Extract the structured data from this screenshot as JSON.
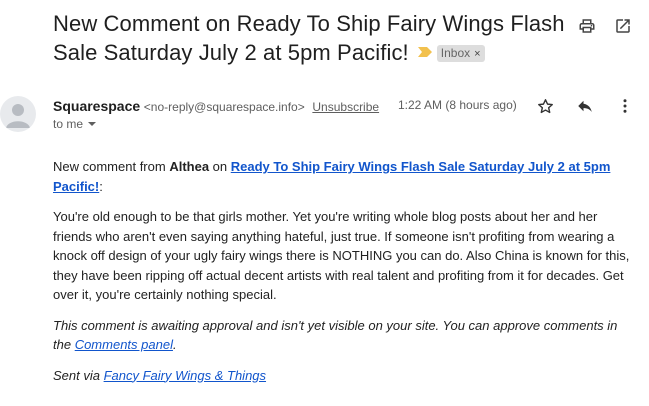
{
  "email": {
    "subject": "New Comment on Ready To Ship Fairy Wings Flash Sale Saturday July 2 at 5pm Pacific!",
    "label": "Inbox",
    "label_remove": "×",
    "sender_name": "Squarespace",
    "sender_email": "<no-reply@squarespace.info>",
    "unsubscribe": "Unsubscribe",
    "time": "1:22 AM (8 hours ago)",
    "to": "to me",
    "colors": {
      "link": "#1155cc",
      "importance_marker": "#f2c14e",
      "label_bg": "#dddddd"
    }
  },
  "body": {
    "intro_prefix": "New comment from ",
    "commenter": "Althea",
    "intro_mid": " on ",
    "post_title": "Ready To Ship Fairy Wings Flash Sale Saturday July 2 at 5pm Pacific!",
    "intro_suffix": ":",
    "comment": "You're old enough to be that girls mother. Yet you're writing whole blog posts about her and her friends who aren't even saying anything hateful, just true. If someone isn't profiting from wearing a knock off design of your ugly fairy wings there is NOTHING you can do. Also China is known for this, they have been ripping off actual decent artists with real talent and profiting from it for decades. Get over it, you're certainly nothing special.",
    "approval_text": "This comment is awaiting approval and isn't yet visible on your site. You can approve comments in the ",
    "comments_panel": "Comments panel",
    "approval_end": ".",
    "sent_via_prefix": "Sent via ",
    "site_name": "Fancy Fairy Wings & Things"
  },
  "icons": {
    "print": "print-icon",
    "open_new": "open-in-new-window-icon",
    "star": "star-icon",
    "reply": "reply-icon",
    "more": "more-vertical-icon",
    "avatar": "person-avatar-icon",
    "dropdown": "chevron-down-icon",
    "important": "importance-marker-icon"
  }
}
